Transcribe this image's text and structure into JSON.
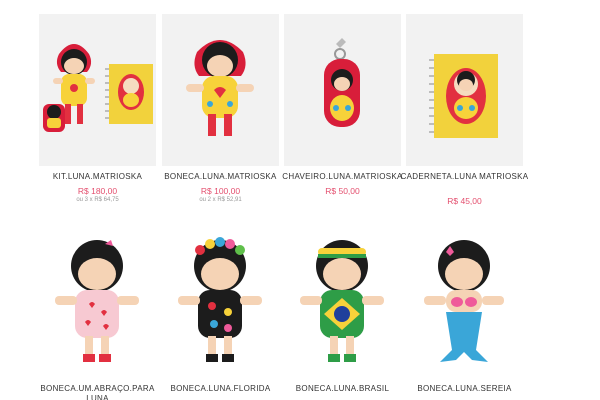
{
  "products_row1": [
    {
      "name": "KIT.LUNA.MATRIOSKA",
      "price": "R$ 180,00",
      "installment": "ou 3 x R$ 64,75"
    },
    {
      "name": "BONECA.LUNA.MATRIOSKA",
      "price": "R$ 100,00",
      "installment": "ou 2 x R$ 52,91"
    },
    {
      "name": "CHAVEIRO.LUNA.MATRIOSKA",
      "price": "R$ 50,00"
    },
    {
      "name": "CADERNETA.LUNA MATRIOSKA",
      "price": "R$ 45,00"
    }
  ],
  "products_row2": [
    {
      "name": "BONECA.UM.ABRAÇO.PARA LUNA"
    },
    {
      "name": "BONECA.LUNA.FLORIDA"
    },
    {
      "name": "BONECA.LUNA.BRASIL"
    },
    {
      "name": "BONECA.LUNA.SEREIA"
    }
  ],
  "colors": {
    "price": "#e4506f",
    "thumb_bg": "#f2f2f2"
  }
}
